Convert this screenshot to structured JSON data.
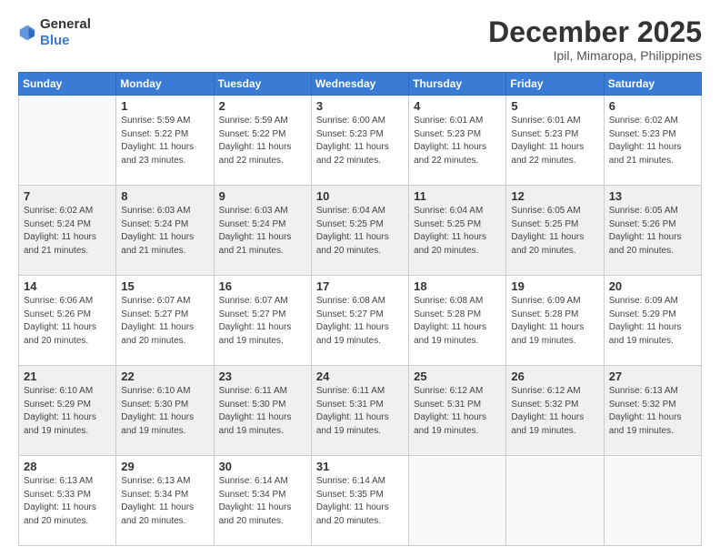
{
  "logo": {
    "general": "General",
    "blue": "Blue"
  },
  "title": {
    "month": "December 2025",
    "location": "Ipil, Mimaropa, Philippines"
  },
  "header_days": [
    "Sunday",
    "Monday",
    "Tuesday",
    "Wednesday",
    "Thursday",
    "Friday",
    "Saturday"
  ],
  "weeks": [
    [
      {
        "day": "",
        "info": ""
      },
      {
        "day": "1",
        "info": "Sunrise: 5:59 AM\nSunset: 5:22 PM\nDaylight: 11 hours\nand 23 minutes."
      },
      {
        "day": "2",
        "info": "Sunrise: 5:59 AM\nSunset: 5:22 PM\nDaylight: 11 hours\nand 22 minutes."
      },
      {
        "day": "3",
        "info": "Sunrise: 6:00 AM\nSunset: 5:23 PM\nDaylight: 11 hours\nand 22 minutes."
      },
      {
        "day": "4",
        "info": "Sunrise: 6:01 AM\nSunset: 5:23 PM\nDaylight: 11 hours\nand 22 minutes."
      },
      {
        "day": "5",
        "info": "Sunrise: 6:01 AM\nSunset: 5:23 PM\nDaylight: 11 hours\nand 22 minutes."
      },
      {
        "day": "6",
        "info": "Sunrise: 6:02 AM\nSunset: 5:23 PM\nDaylight: 11 hours\nand 21 minutes."
      }
    ],
    [
      {
        "day": "7",
        "info": "Sunrise: 6:02 AM\nSunset: 5:24 PM\nDaylight: 11 hours\nand 21 minutes."
      },
      {
        "day": "8",
        "info": "Sunrise: 6:03 AM\nSunset: 5:24 PM\nDaylight: 11 hours\nand 21 minutes."
      },
      {
        "day": "9",
        "info": "Sunrise: 6:03 AM\nSunset: 5:24 PM\nDaylight: 11 hours\nand 21 minutes."
      },
      {
        "day": "10",
        "info": "Sunrise: 6:04 AM\nSunset: 5:25 PM\nDaylight: 11 hours\nand 20 minutes."
      },
      {
        "day": "11",
        "info": "Sunrise: 6:04 AM\nSunset: 5:25 PM\nDaylight: 11 hours\nand 20 minutes."
      },
      {
        "day": "12",
        "info": "Sunrise: 6:05 AM\nSunset: 5:25 PM\nDaylight: 11 hours\nand 20 minutes."
      },
      {
        "day": "13",
        "info": "Sunrise: 6:05 AM\nSunset: 5:26 PM\nDaylight: 11 hours\nand 20 minutes."
      }
    ],
    [
      {
        "day": "14",
        "info": "Sunrise: 6:06 AM\nSunset: 5:26 PM\nDaylight: 11 hours\nand 20 minutes."
      },
      {
        "day": "15",
        "info": "Sunrise: 6:07 AM\nSunset: 5:27 PM\nDaylight: 11 hours\nand 20 minutes."
      },
      {
        "day": "16",
        "info": "Sunrise: 6:07 AM\nSunset: 5:27 PM\nDaylight: 11 hours\nand 19 minutes."
      },
      {
        "day": "17",
        "info": "Sunrise: 6:08 AM\nSunset: 5:27 PM\nDaylight: 11 hours\nand 19 minutes."
      },
      {
        "day": "18",
        "info": "Sunrise: 6:08 AM\nSunset: 5:28 PM\nDaylight: 11 hours\nand 19 minutes."
      },
      {
        "day": "19",
        "info": "Sunrise: 6:09 AM\nSunset: 5:28 PM\nDaylight: 11 hours\nand 19 minutes."
      },
      {
        "day": "20",
        "info": "Sunrise: 6:09 AM\nSunset: 5:29 PM\nDaylight: 11 hours\nand 19 minutes."
      }
    ],
    [
      {
        "day": "21",
        "info": "Sunrise: 6:10 AM\nSunset: 5:29 PM\nDaylight: 11 hours\nand 19 minutes."
      },
      {
        "day": "22",
        "info": "Sunrise: 6:10 AM\nSunset: 5:30 PM\nDaylight: 11 hours\nand 19 minutes."
      },
      {
        "day": "23",
        "info": "Sunrise: 6:11 AM\nSunset: 5:30 PM\nDaylight: 11 hours\nand 19 minutes."
      },
      {
        "day": "24",
        "info": "Sunrise: 6:11 AM\nSunset: 5:31 PM\nDaylight: 11 hours\nand 19 minutes."
      },
      {
        "day": "25",
        "info": "Sunrise: 6:12 AM\nSunset: 5:31 PM\nDaylight: 11 hours\nand 19 minutes."
      },
      {
        "day": "26",
        "info": "Sunrise: 6:12 AM\nSunset: 5:32 PM\nDaylight: 11 hours\nand 19 minutes."
      },
      {
        "day": "27",
        "info": "Sunrise: 6:13 AM\nSunset: 5:32 PM\nDaylight: 11 hours\nand 19 minutes."
      }
    ],
    [
      {
        "day": "28",
        "info": "Sunrise: 6:13 AM\nSunset: 5:33 PM\nDaylight: 11 hours\nand 20 minutes."
      },
      {
        "day": "29",
        "info": "Sunrise: 6:13 AM\nSunset: 5:34 PM\nDaylight: 11 hours\nand 20 minutes."
      },
      {
        "day": "30",
        "info": "Sunrise: 6:14 AM\nSunset: 5:34 PM\nDaylight: 11 hours\nand 20 minutes."
      },
      {
        "day": "31",
        "info": "Sunrise: 6:14 AM\nSunset: 5:35 PM\nDaylight: 11 hours\nand 20 minutes."
      },
      {
        "day": "",
        "info": ""
      },
      {
        "day": "",
        "info": ""
      },
      {
        "day": "",
        "info": ""
      }
    ]
  ]
}
